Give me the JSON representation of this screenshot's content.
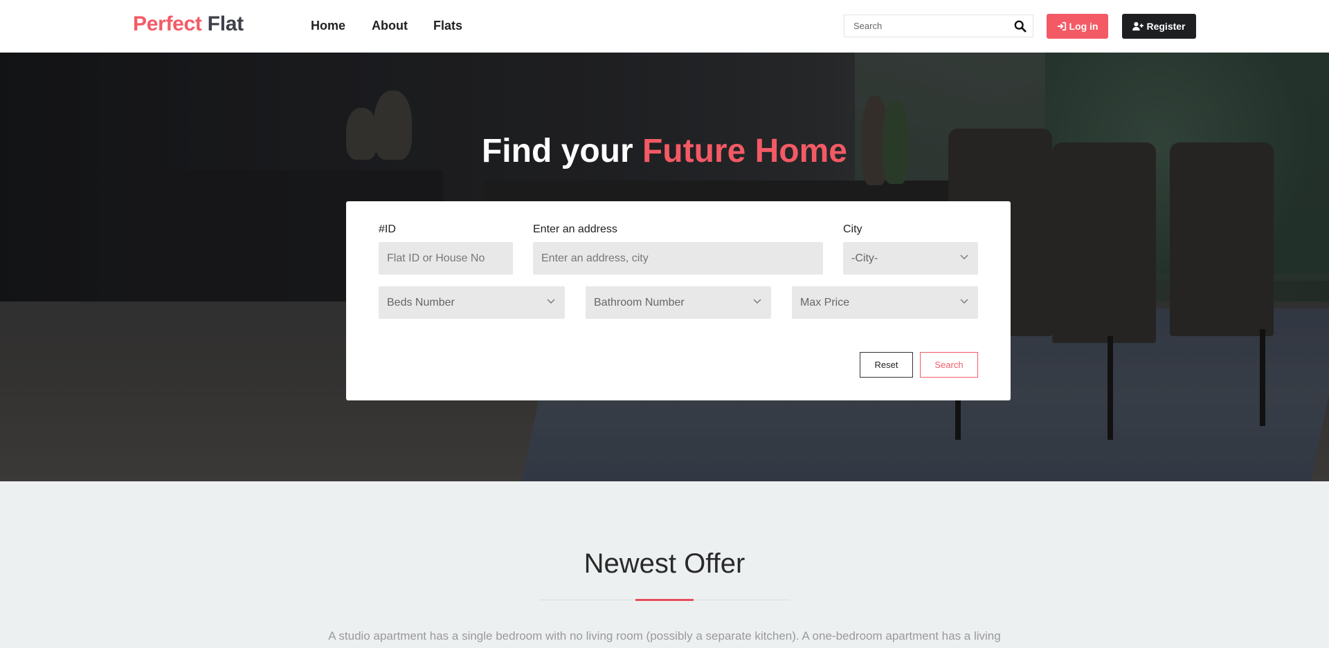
{
  "brand": {
    "part1": "Perfect",
    "part2": "Flat"
  },
  "nav": {
    "home": "Home",
    "about": "About",
    "flats": "Flats"
  },
  "search": {
    "placeholder": "Search"
  },
  "auth": {
    "login": "Log in",
    "register": "Register"
  },
  "hero": {
    "title_plain": "Find your",
    "title_accent": "Future Home"
  },
  "form": {
    "id_label": "#ID",
    "id_placeholder": "Flat ID or House No",
    "address_label": "Enter an address",
    "address_placeholder": "Enter an address, city",
    "city_label": "City",
    "city_value": "-City-",
    "beds_value": "Beds Number",
    "bath_value": "Bathroom Number",
    "price_value": "Max Price",
    "reset_label": "Reset",
    "search_label": "Search"
  },
  "offer": {
    "title": "Newest Offer",
    "text": "A studio apartment has a single bedroom with no living room (possibly a separate kitchen). A one-bedroom apartment has a living"
  },
  "colors": {
    "accent": "#f35a65",
    "dark": "#1e1f21"
  }
}
